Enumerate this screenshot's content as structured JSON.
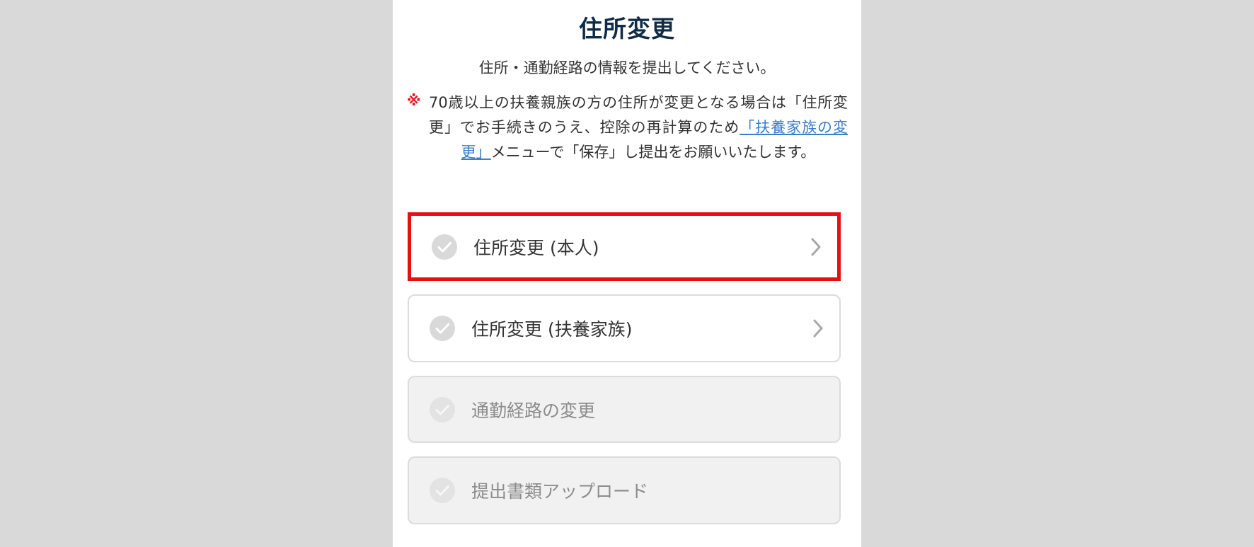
{
  "page": {
    "title": "住所変更",
    "subtitle": "住所・通勤経路の情報を提出してください。"
  },
  "notice": {
    "mark": "※",
    "text_before": "70歳以上の扶養親族の方の住所が変更となる場合は「住所変更」でお手続きのうえ、控除の再計算のため",
    "link_text": "「扶養家族の変更」",
    "text_after": "メニューで「保存」し提出をお願いいたします。"
  },
  "menu": {
    "items": [
      {
        "label": "住所変更 (本人)",
        "enabled": true,
        "highlighted": true,
        "has_chevron": true,
        "icon": "check-circle-icon"
      },
      {
        "label": "住所変更 (扶養家族)",
        "enabled": true,
        "highlighted": false,
        "has_chevron": true,
        "icon": "check-circle-icon"
      },
      {
        "label": "通勤経路の変更",
        "enabled": false,
        "highlighted": false,
        "has_chevron": false,
        "icon": "check-circle-icon"
      },
      {
        "label": "提出書類アップロード",
        "enabled": false,
        "highlighted": false,
        "has_chevron": false,
        "icon": "check-circle-icon"
      }
    ]
  },
  "colors": {
    "title": "#0f2b46",
    "notice_mark": "#e8131a",
    "link": "#3b7dc9",
    "highlight_border": "#e50f14",
    "check_icon": "#d9d9d9",
    "disabled_background": "#f1f1f1",
    "page_background": "#d9d9d9"
  }
}
